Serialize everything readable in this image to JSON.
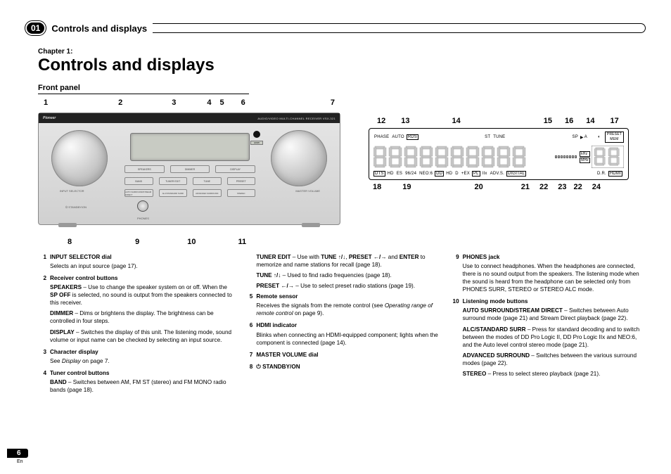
{
  "header": {
    "section_num": "01",
    "section_title": "Controls and displays"
  },
  "chapter": {
    "label": "Chapter 1:",
    "title": "Controls and displays"
  },
  "front_panel": {
    "subhead": "Front panel",
    "callouts_top": [
      "1",
      "2",
      "3",
      "4",
      "5",
      "6",
      "7"
    ],
    "callouts_bottom": [
      "8",
      "9",
      "10",
      "11"
    ],
    "brand": "Pioneer",
    "model": "AUDIO/VIDEO MULTI-CHANNEL RECEIVER   VSX-321",
    "labels": {
      "input_selector": "INPUT SELECTOR",
      "standby": "STANDBY/ON",
      "phones": "PHONES",
      "master": "MASTER VOLUME",
      "hdmi": "HDMI"
    },
    "row1": [
      "SPEAKERS",
      "DIMMER",
      "DISPLAY"
    ],
    "row2": [
      "BAND",
      "TUNER EDIT",
      "TUNE",
      "PRESET"
    ],
    "row3": [
      "AUTO SURROUND/STREAM DIRECT",
      "ALC/STANDARD SURR",
      "ADVANCED SURROUND",
      "STEREO"
    ]
  },
  "display_panel": {
    "callouts_top": [
      "12",
      "13",
      "14",
      "15",
      "16",
      "14",
      "17"
    ],
    "callouts_bottom": [
      "18",
      "19",
      "20",
      "21",
      "22",
      "23",
      "22",
      "24"
    ],
    "row_top": {
      "phase": "PHASE",
      "auto": "AUTO",
      "rds": "RDS",
      "st": "ST",
      "tune": "TUNE",
      "sp": "SP",
      "a": "A",
      "preset": "PRESET",
      "mem": "MEM"
    },
    "units": {
      "khz": "kHz",
      "mhz": "MHz"
    },
    "row_bot": {
      "dts": "DTS",
      "hd": "HD",
      "es": "ES",
      "n9624": "96/24",
      "neo6": "NEO:6",
      "dd": "DD",
      "hd2": "HD",
      "d": "D",
      "ex": "+EX",
      "pl": "PL",
      "iix": "IIx",
      "advs": "ADV.S.",
      "digital": "DIGITAL",
      "dr": "D.R.",
      "hdmi": "HDMI"
    }
  },
  "descriptions": {
    "col1": [
      {
        "n": "1",
        "title": "INPUT SELECTOR dial",
        "body": "Selects an input source (page 17).",
        "subs": []
      },
      {
        "n": "2",
        "title": "Receiver control buttons",
        "body": "",
        "subs": [
          {
            "lead": "SPEAKERS",
            "text": " – Use to change the speaker system on or off. When the ",
            "lead2": "SP OFF",
            "text2": " is selected, no sound is output from the speakers connected to this receiver."
          },
          {
            "lead": "DIMMER",
            "text": " – Dims or brightens the display. The brightness can be controlled in four steps."
          },
          {
            "lead": "DISPLAY",
            "text": " – Switches the display of this unit. The listening mode, sound volume or input name can be checked by selecting an input source."
          }
        ]
      },
      {
        "n": "3",
        "title": "Character display",
        "body": "See Display on page 7.",
        "subs": []
      },
      {
        "n": "4",
        "title": "Tuner control buttons",
        "body": "",
        "subs": [
          {
            "lead": "BAND",
            "text": " – Switches between AM, FM ST (stereo) and FM MONO radio bands (page 18)."
          }
        ]
      }
    ],
    "col2": [
      {
        "subs": [
          {
            "lead": "TUNER EDIT",
            "text": " – Use with ",
            "sym1": "TUNE ↑/↓",
            "mid": ", ",
            "sym2": "PRESET ←/→",
            "tail": " and ",
            "lead2": "ENTER",
            "text2": " to memorize and name stations for recall (page 18)."
          },
          {
            "lead": "TUNE ↑/↓",
            "text": " – Used to find radio frequencies (page 18)."
          },
          {
            "lead": "PRESET ←/→",
            "text": " – Use to select preset radio stations (page 19)."
          }
        ]
      },
      {
        "n": "5",
        "title": "Remote sensor",
        "body": "Receives the signals from the remote control (see Operating range of remote control on page 9).",
        "it": true
      },
      {
        "n": "6",
        "title": "HDMI indicator",
        "body": "Blinks when connecting an HDMI-equipped component; lights when the component is connected (page 14)."
      },
      {
        "n": "7",
        "title": "MASTER VOLUME dial",
        "body": ""
      },
      {
        "n": "8",
        "title": "⏻ STANDBY/ON",
        "body": ""
      }
    ],
    "col3": [
      {
        "n": "9",
        "title": "PHONES jack",
        "body": "Use to connect headphones. When the headphones are connected, there is no sound output from the speakers. The listening mode when the sound is heard from the headphone can be selected only from ",
        "tail_bold": "PHONES SURR, STEREO",
        "tail_mid": " or ",
        "tail_bold2": "STEREO ALC",
        "tail_end": " mode."
      },
      {
        "n": "10",
        "title": "Listening mode buttons",
        "body": "",
        "subs": [
          {
            "lead": "AUTO SURROUND/STREAM DIRECT",
            "text": " – Switches between Auto surround mode (page 21) and Stream Direct playback (page 22)."
          },
          {
            "lead": "ALC/STANDARD SURR",
            "text": " – Press for standard decoding and to switch between the modes of DD Pro Logic II, DD Pro Logic IIx and NEO:6, and the Auto level control stereo mode (page 21)."
          },
          {
            "lead": "ADVANCED SURROUND",
            "text": " – Switches between the various surround modes (page 22)."
          },
          {
            "lead": "STEREO",
            "text": " – Press to select stereo playback (page 21)."
          }
        ]
      }
    ]
  },
  "footer": {
    "page": "6",
    "lang": "En"
  }
}
